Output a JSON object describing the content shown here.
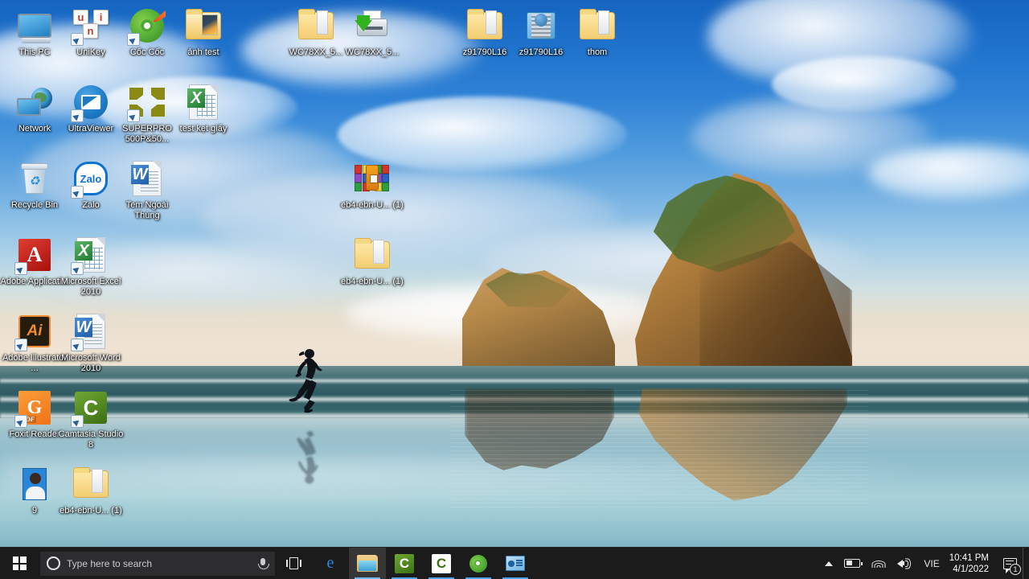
{
  "desktop": {
    "wallpaper_name": "archway-islands-beach-wallpaper",
    "icons": [
      {
        "label": "This PC",
        "icon": "this-pc-icon",
        "col": 0,
        "row": 0,
        "shortcut": false
      },
      {
        "label": "UniKey",
        "icon": "unikey-icon",
        "col": 1,
        "row": 0,
        "shortcut": true
      },
      {
        "label": "Cốc Cốc",
        "icon": "coccoc-browser-icon",
        "col": 2,
        "row": 0,
        "shortcut": true
      },
      {
        "label": "ảnh test",
        "icon": "folder-images-icon",
        "col": 3,
        "row": 0,
        "shortcut": false
      },
      {
        "label": "WC78XX_5...",
        "icon": "folder-icon",
        "col": 5,
        "row": 0,
        "shortcut": false
      },
      {
        "label": "WC78XX_5...",
        "icon": "printer-driver-icon",
        "col": 6,
        "row": 0,
        "shortcut": false
      },
      {
        "label": "z91790L16",
        "icon": "folder-icon",
        "col": 8,
        "row": 0,
        "shortcut": false
      },
      {
        "label": "z91790L16",
        "icon": "zip-archive-icon",
        "col": 9,
        "row": 0,
        "shortcut": false
      },
      {
        "label": "thom",
        "icon": "folder-icon",
        "col": 10,
        "row": 0,
        "shortcut": false
      },
      {
        "label": "Network",
        "icon": "network-icon",
        "col": 0,
        "row": 1,
        "shortcut": false
      },
      {
        "label": "UltraViewer",
        "icon": "ultraviewer-icon",
        "col": 1,
        "row": 1,
        "shortcut": true
      },
      {
        "label": "SUPERPRO 500P&50...",
        "icon": "superpro-icon",
        "col": 2,
        "row": 1,
        "shortcut": true
      },
      {
        "label": "test kẹt giấy",
        "icon": "excel-document-icon",
        "col": 3,
        "row": 1,
        "shortcut": false
      },
      {
        "label": "Recycle Bin",
        "icon": "recycle-bin-icon",
        "col": 0,
        "row": 2,
        "shortcut": false
      },
      {
        "label": "Zalo",
        "icon": "zalo-icon",
        "col": 1,
        "row": 2,
        "shortcut": true
      },
      {
        "label": "Tem Ngoài Thùng",
        "icon": "word-document-icon",
        "col": 2,
        "row": 2,
        "shortcut": false
      },
      {
        "label": "eb4-ebn-U... (1)",
        "icon": "winrar-archive-icon",
        "col": 6,
        "row": 2,
        "shortcut": false
      },
      {
        "label": "Adobe Applicati...",
        "icon": "adobe-application-icon",
        "col": 0,
        "row": 3,
        "shortcut": true
      },
      {
        "label": "Microsoft Excel 2010",
        "icon": "excel-app-icon",
        "col": 1,
        "row": 3,
        "shortcut": true
      },
      {
        "label": "eb4-ebn-U... (1)",
        "icon": "folder-icon",
        "col": 6,
        "row": 3,
        "shortcut": false
      },
      {
        "label": "Adobe Illustrator ...",
        "icon": "adobe-illustrator-icon",
        "col": 0,
        "row": 4,
        "shortcut": true
      },
      {
        "label": "Microsoft Word 2010",
        "icon": "word-app-icon",
        "col": 1,
        "row": 4,
        "shortcut": true
      },
      {
        "label": "Foxit Reader",
        "icon": "foxit-reader-icon",
        "col": 0,
        "row": 5,
        "shortcut": true
      },
      {
        "label": "Camtasia Studio 8",
        "icon": "camtasia-icon",
        "col": 1,
        "row": 5,
        "shortcut": true
      },
      {
        "label": "9",
        "icon": "photo-thumbnail-icon",
        "col": 0,
        "row": 6,
        "shortcut": false
      },
      {
        "label": "eb4-ebn-U... (1)",
        "icon": "folder-icon",
        "col": 1,
        "row": 6,
        "shortcut": false
      }
    ]
  },
  "taskbar": {
    "start_label": "Start",
    "search": {
      "placeholder": "Type here to search",
      "value": "",
      "cortana_icon": "cortana-circle-icon",
      "mic_icon": "microphone-icon"
    },
    "buttons": [
      {
        "name": "task-view-button",
        "icon": "task-view-icon",
        "active": false,
        "running": false
      },
      {
        "name": "edge-button",
        "icon": "microsoft-edge-icon",
        "active": false,
        "running": false,
        "glyph": "e"
      },
      {
        "name": "file-explorer-button",
        "icon": "file-explorer-icon",
        "active": true,
        "running": true
      },
      {
        "name": "camtasia-button-1",
        "icon": "camtasia-icon",
        "active": false,
        "running": true,
        "glyph": "C"
      },
      {
        "name": "camtasia-button-2",
        "icon": "camtasia-icon-light",
        "active": false,
        "running": true,
        "glyph": "C"
      },
      {
        "name": "coccoc-button",
        "icon": "coccoc-browser-icon",
        "active": false,
        "running": true
      },
      {
        "name": "presentation-button",
        "icon": "presentation-app-icon",
        "active": false,
        "running": true
      }
    ],
    "tray": {
      "overflow_icon": "chevron-up-icon",
      "battery_icon": "battery-charging-icon",
      "wifi_icon": "wifi-icon",
      "volume_icon": "volume-icon",
      "language": "VIE",
      "time": "10:41 PM",
      "date": "4/1/2022",
      "action_center_icon": "action-center-icon",
      "notification_count": "1"
    }
  },
  "colors": {
    "taskbar_bg": "#1b1b1c",
    "search_bg": "#2d2d30",
    "accent": "#4aa3e8",
    "label_text": "#ffffff"
  }
}
